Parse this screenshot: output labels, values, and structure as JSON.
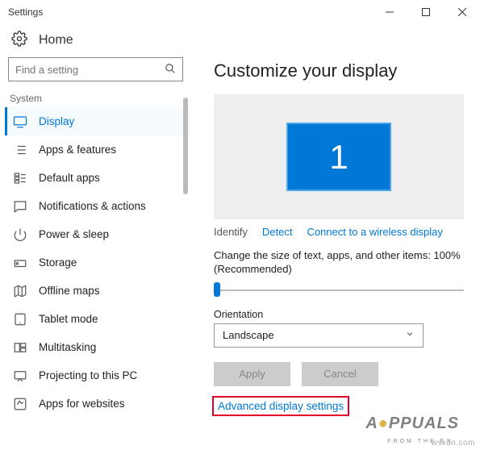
{
  "window": {
    "title": "Settings"
  },
  "header": {
    "home": "Home"
  },
  "search": {
    "placeholder": "Find a setting"
  },
  "sidebar": {
    "section": "System",
    "items": [
      {
        "label": "Display"
      },
      {
        "label": "Apps & features"
      },
      {
        "label": "Default apps"
      },
      {
        "label": "Notifications & actions"
      },
      {
        "label": "Power & sleep"
      },
      {
        "label": "Storage"
      },
      {
        "label": "Offline maps"
      },
      {
        "label": "Tablet mode"
      },
      {
        "label": "Multitasking"
      },
      {
        "label": "Projecting to this PC"
      },
      {
        "label": "Apps for websites"
      }
    ]
  },
  "main": {
    "title": "Customize your display",
    "monitor_number": "1",
    "identify": "Identify",
    "detect": "Detect",
    "connect_wireless": "Connect to a wireless display",
    "scale_label": "Change the size of text, apps, and other items: 100% (Recommended)",
    "orientation_label": "Orientation",
    "orientation_value": "Landscape",
    "apply": "Apply",
    "cancel": "Cancel",
    "advanced": "Advanced display settings"
  },
  "watermark": {
    "site": "wsxdn.com",
    "brand_pre": "A",
    "brand_mid": "PPUALS",
    "brand_sub": "FROM  THE  EX"
  }
}
